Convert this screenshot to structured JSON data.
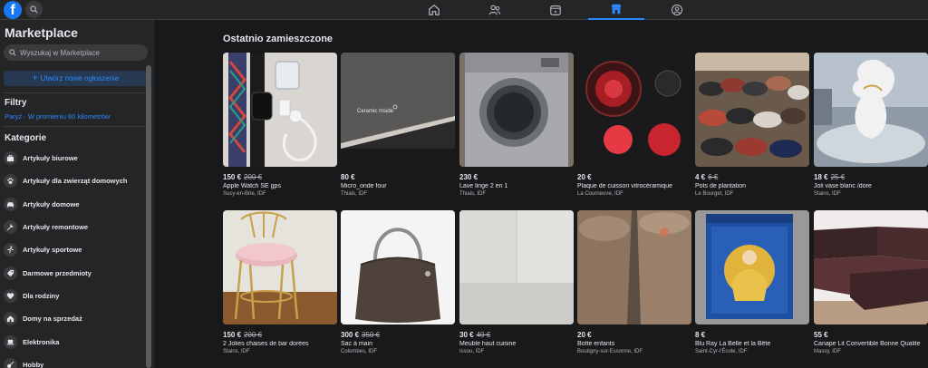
{
  "header": {
    "logo_letter": "f",
    "nav": [
      {
        "icon": "home-icon"
      },
      {
        "icon": "friends-icon"
      },
      {
        "icon": "watch-icon"
      },
      {
        "icon": "marketplace-icon",
        "active": true
      },
      {
        "icon": "groups-icon"
      }
    ]
  },
  "sidebar": {
    "title": "Marketplace",
    "search_placeholder": "Wyszukaj w Marketplace",
    "create_label": "Utwórz nowe ogłoszenie",
    "filters_heading": "Filtry",
    "location": "Paryż · W promieniu 60 kilometrów",
    "categories_heading": "Kategorie",
    "categories": [
      {
        "label": "Artykuły biurowe",
        "icon": "briefcase-icon"
      },
      {
        "label": "Artykuły dla zwierząt domowych",
        "icon": "paw-icon"
      },
      {
        "label": "Artykuły domowe",
        "icon": "sofa-icon"
      },
      {
        "label": "Artykuły remontowe",
        "icon": "wrench-icon"
      },
      {
        "label": "Artykuły sportowe",
        "icon": "runner-icon"
      },
      {
        "label": "Darmowe przedmioty",
        "icon": "tag-icon"
      },
      {
        "label": "Dla rodziny",
        "icon": "heart-icon"
      },
      {
        "label": "Domy na sprzedaż",
        "icon": "house-icon"
      },
      {
        "label": "Elektronika",
        "icon": "laptop-icon"
      },
      {
        "label": "Hobby",
        "icon": "guitar-icon"
      }
    ]
  },
  "main": {
    "title": "Ostatnio zamieszczone",
    "listings": [
      {
        "price": "150 €",
        "old_price": "200 €",
        "title": "Apple Watch SE gps",
        "location": "Sucy-en-Brie, IDF",
        "image": "watch-photo"
      },
      {
        "price": "80 €",
        "old_price": "",
        "title": "Micro_onde four",
        "location": "Thiais, IDF",
        "image": "microwave-photo",
        "image_text": "Ceramic Inside"
      },
      {
        "price": "230 €",
        "old_price": "",
        "title": "Lave linge 2 en 1",
        "location": "Thiais, IDF",
        "image": "washer-photo"
      },
      {
        "price": "20 €",
        "old_price": "",
        "title": "Plaque de cuisson vitrocéramique",
        "location": "La Courneuve, IDF",
        "image": "cooktop-photo"
      },
      {
        "price": "4 €",
        "old_price": "6 €",
        "title": "Pots de plantation",
        "location": "Le Bourget, IDF",
        "image": "pots-photo"
      },
      {
        "price": "18 €",
        "old_price": "25 €",
        "title": "Joli vase blanc /dore",
        "location": "Stains, IDF",
        "image": "vase-photo"
      },
      {
        "price": "150 €",
        "old_price": "200 €",
        "title": "2 Jolies chaises de bar dorées",
        "location": "Stains, IDF",
        "image": "chair-photo"
      },
      {
        "price": "300 €",
        "old_price": "350 €",
        "title": "Sac à main",
        "location": "Colombes, IDF",
        "image": "bag-photo"
      },
      {
        "price": "30 €",
        "old_price": "40 €",
        "title": "Meuble haut cuisine",
        "location": "Issou, IDF",
        "image": "cabinet-photo"
      },
      {
        "price": "20 €",
        "old_price": "",
        "title": "Botte enfants",
        "location": "Boutigny-sur-Essonne, IDF",
        "image": "boots-photo"
      },
      {
        "price": "8 €",
        "old_price": "",
        "title": "Blu Ray La Belle et la Bête",
        "location": "Saint-Cyr-l'École, IDF",
        "image": "bluray-photo"
      },
      {
        "price": "55 €",
        "old_price": "",
        "title": "Canape Lit Convertible Bonne Qualite",
        "location": "Massy, IDF",
        "image": "sofa-photo"
      }
    ]
  }
}
